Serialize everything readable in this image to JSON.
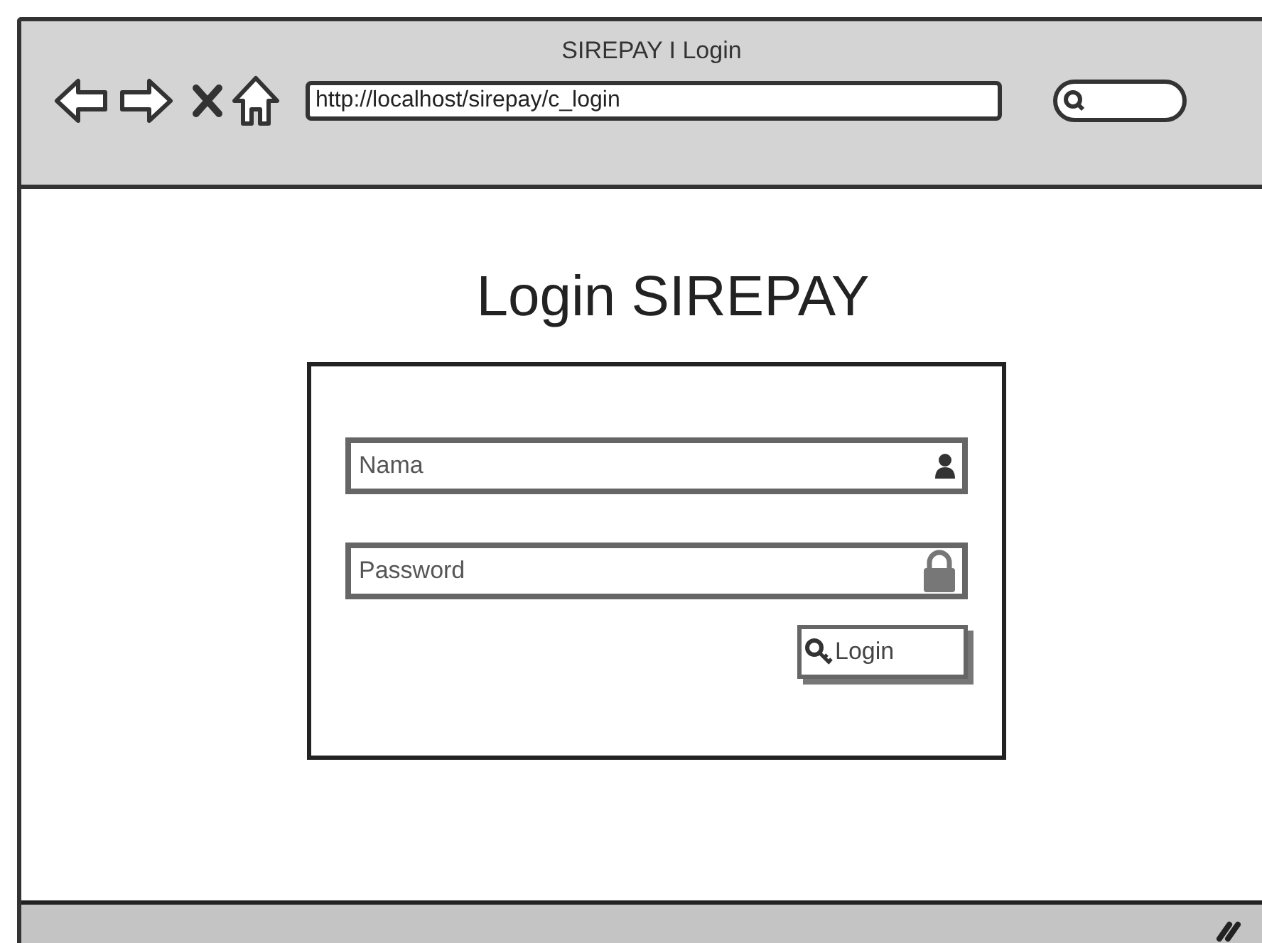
{
  "window": {
    "title": "SIREPAY I Login"
  },
  "toolbar": {
    "address": "http://localhost/sirepay/c_login"
  },
  "heading": "Login SIREPAY",
  "form": {
    "fields": [
      {
        "kind": "user",
        "placeholder": "Nama"
      },
      {
        "kind": "password",
        "placeholder": "Password"
      }
    ],
    "button": "Login"
  }
}
